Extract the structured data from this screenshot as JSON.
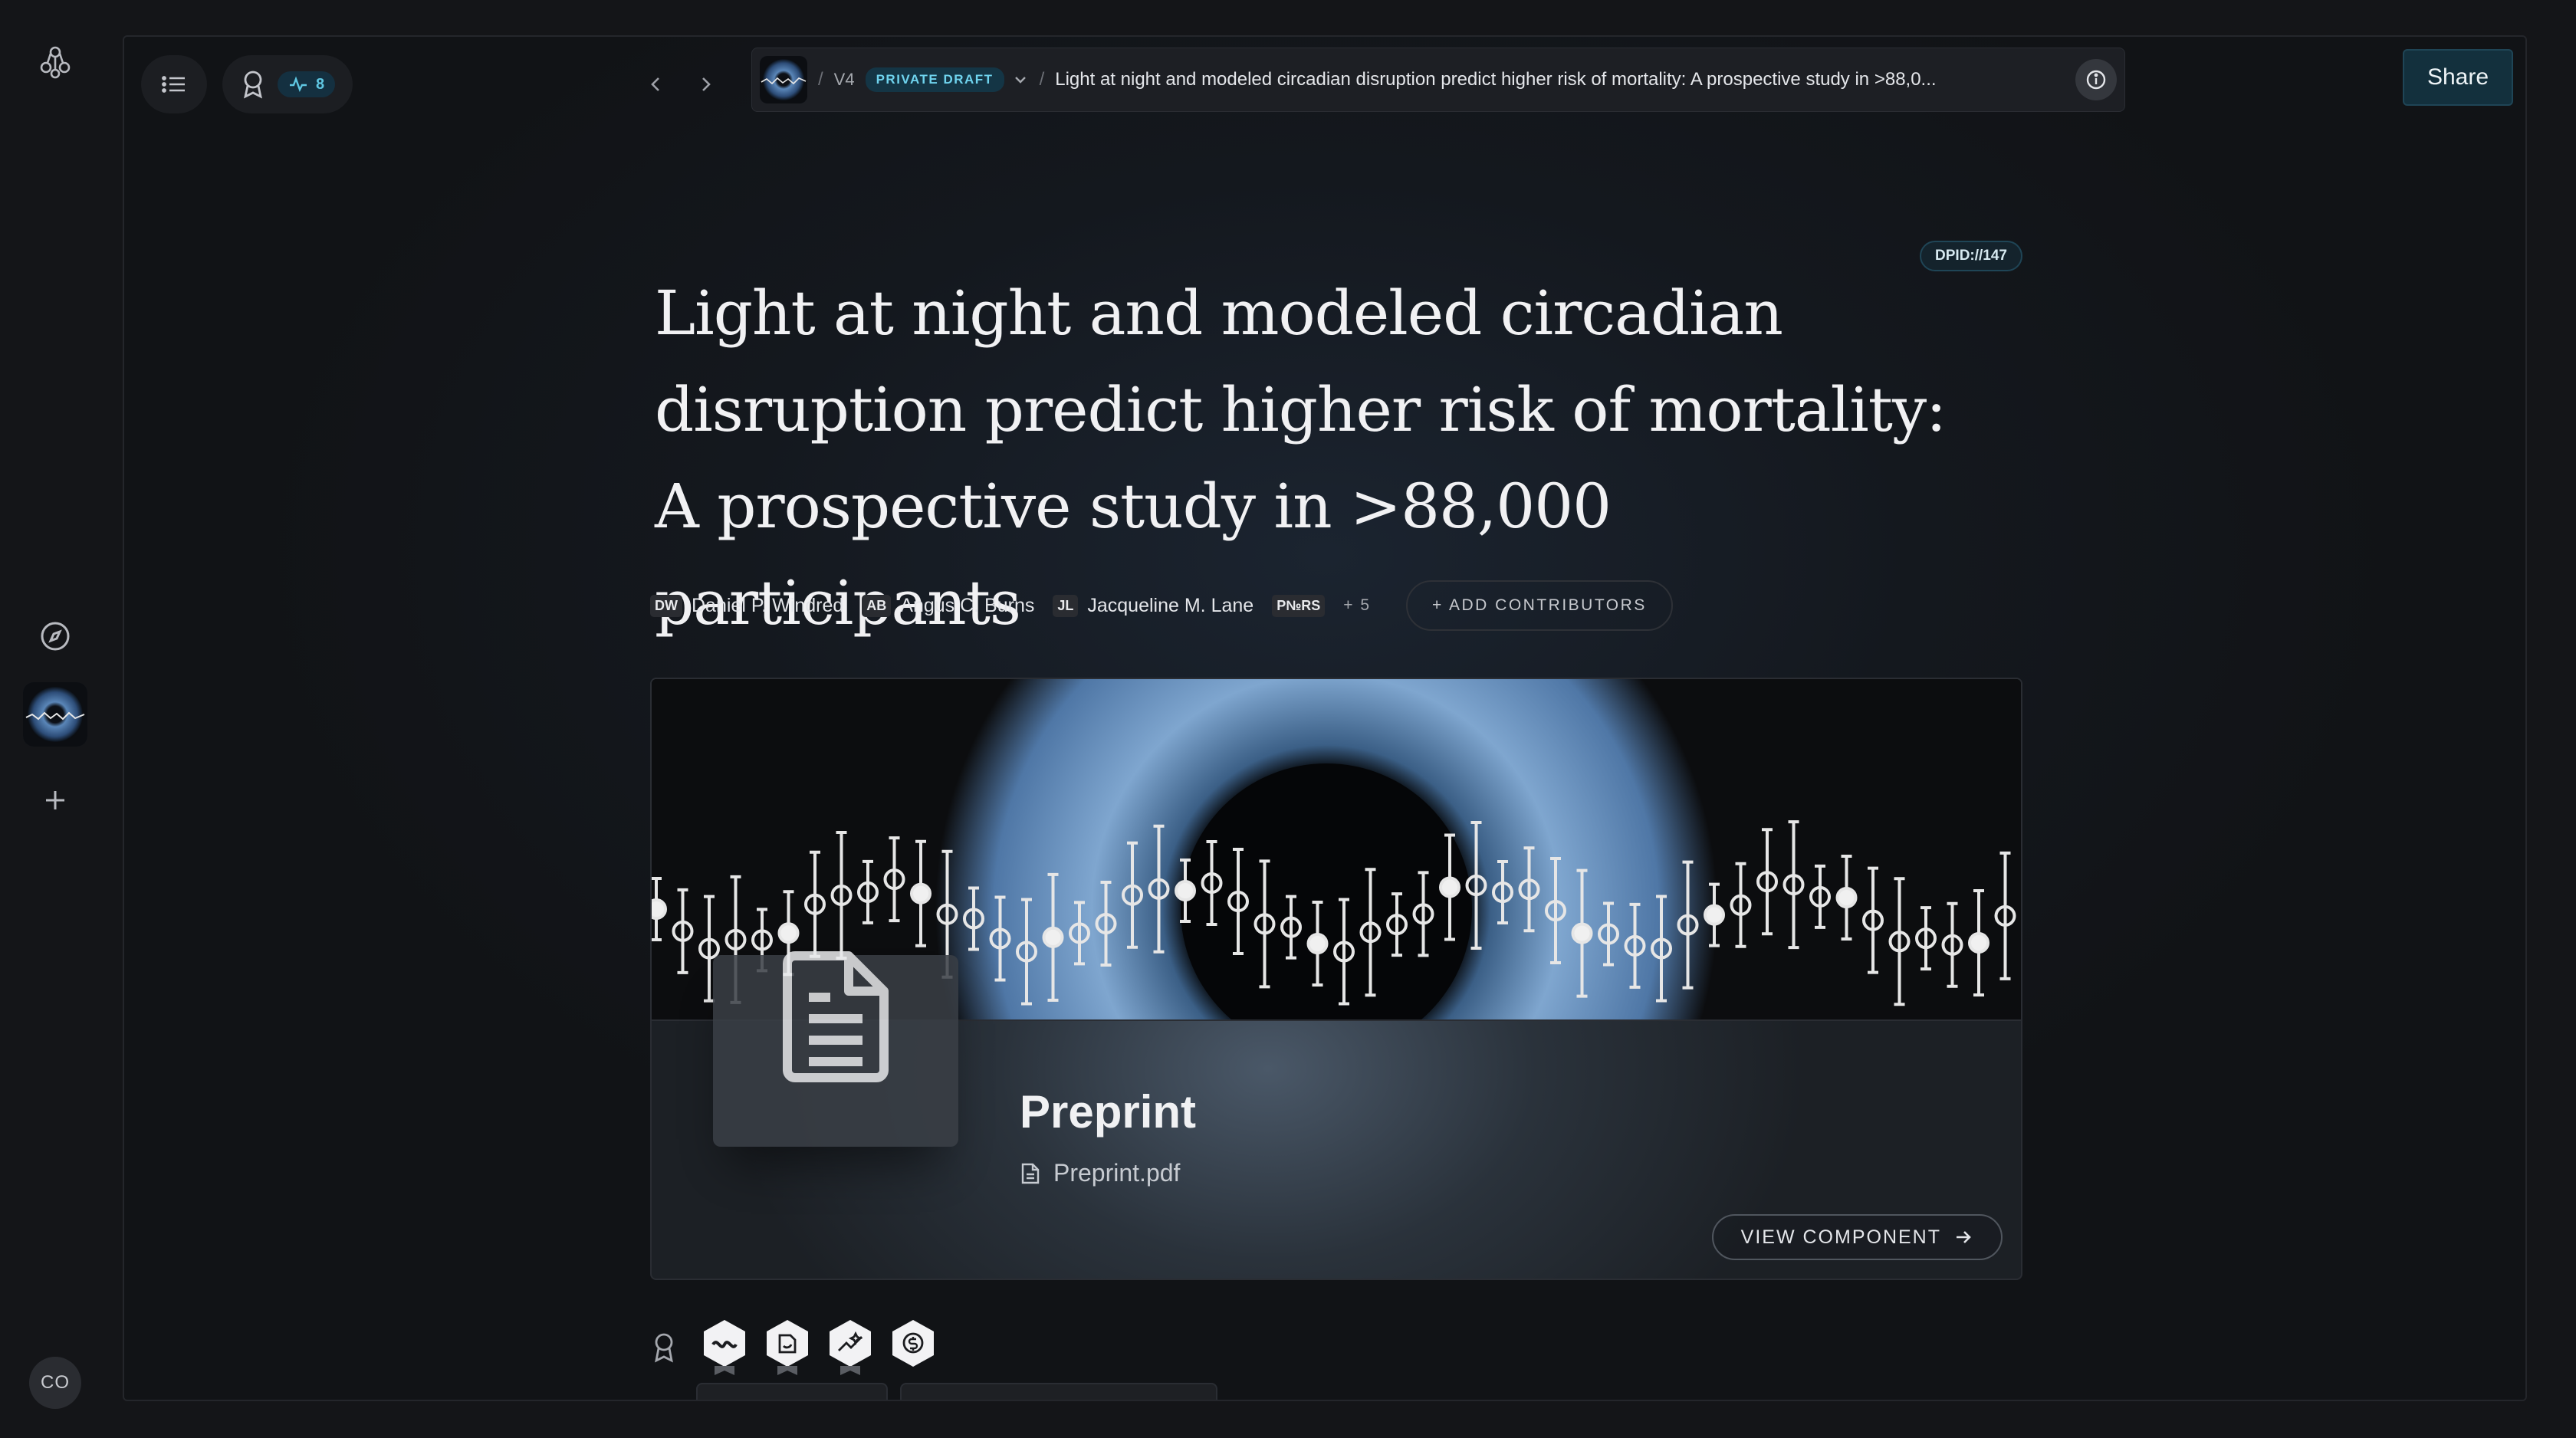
{
  "rail": {
    "user_initials": "CO"
  },
  "topbar": {
    "activity_count": "8",
    "breadcrumb": {
      "version": "V4",
      "status_badge": "PRIVATE DRAFT",
      "separator": "/",
      "title": "Light at night and modeled circadian disruption predict higher risk of mortality: A prospective study in >88,0..."
    },
    "share_label": "Share"
  },
  "document": {
    "dpid": "DPID://147",
    "title": "Light at night and modeled circadian disruption predict higher risk of mortality: A prospective study in >88,000 participants",
    "authors": [
      {
        "initials": "DW",
        "name": "Daniel P. Windred"
      },
      {
        "initials": "AB",
        "name": "Angus C. Burns"
      },
      {
        "initials": "JL",
        "name": "Jacqueline M. Lane"
      }
    ],
    "stacked_initials": "P№RS",
    "more_authors": "+ 5",
    "add_contributors_label": "+ ADD CONTRIBUTORS"
  },
  "component_card": {
    "title": "Preprint",
    "file_name": "Preprint.pdf",
    "view_label": "VIEW COMPONENT"
  },
  "badges": [
    "wave-badge-icon",
    "refresh-doc-badge-icon",
    "sparkle-badge-icon",
    "dollar-badge-icon"
  ],
  "colors": {
    "accent": "#5fc7e2",
    "share_bg": "#13303d",
    "draft_badge_bg": "#143545"
  }
}
